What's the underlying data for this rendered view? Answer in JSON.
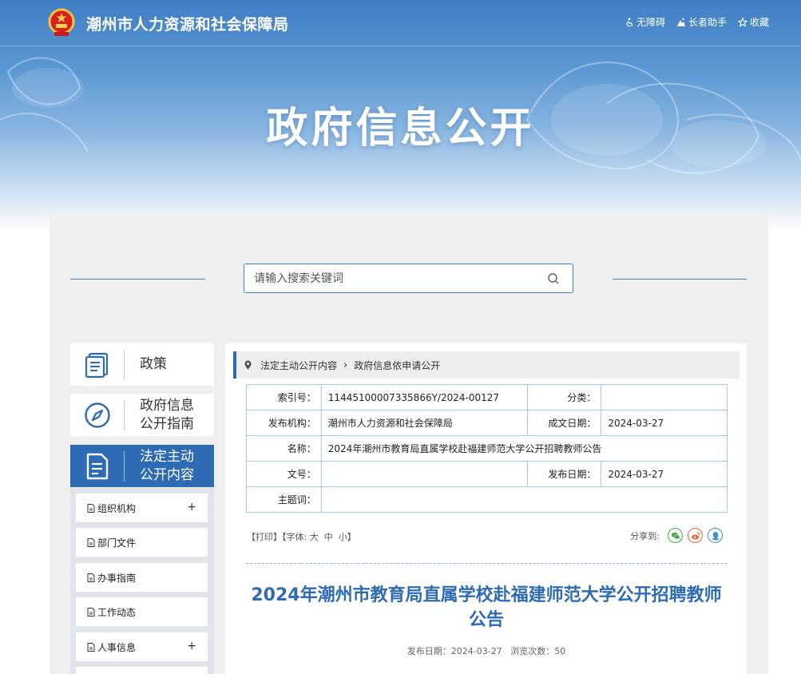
{
  "header": {
    "site_name": "潮州市人力资源和社会保障局",
    "tools": [
      {
        "label": "无障碍",
        "icon": "accessibility-icon"
      },
      {
        "label": "长者助手",
        "icon": "elder-assistant-icon"
      },
      {
        "label": "收藏",
        "icon": "star-icon"
      }
    ],
    "hero_title": "政府信息公开"
  },
  "search": {
    "placeholder": "请输入搜索关键词"
  },
  "nav": {
    "main": [
      {
        "label_lines": [
          "政策"
        ],
        "icon": "book-icon",
        "active": false
      },
      {
        "label_lines": [
          "政府信息",
          "公开指南"
        ],
        "icon": "compass-icon",
        "active": false
      },
      {
        "label_lines": [
          "法定主动",
          "公开内容"
        ],
        "icon": "document-icon",
        "active": true
      }
    ],
    "sub": [
      {
        "label": "组织机构",
        "expandable": true
      },
      {
        "label": "部门文件",
        "expandable": false
      },
      {
        "label": "办事指南",
        "expandable": false
      },
      {
        "label": "工作动态",
        "expandable": false
      },
      {
        "label": "人事信息",
        "expandable": true
      }
    ],
    "expand_symbol": "+"
  },
  "breadcrumb": {
    "items": [
      "法定主动公开内容",
      "政府信息依申请公开"
    ],
    "separator": "›"
  },
  "meta": {
    "index_label": "索引号：",
    "index_value": "11445100007335866Y/2024-00127",
    "category_label": "分类：",
    "category_value": "",
    "publisher_label": "发布机构：",
    "publisher_value": "潮州市人力资源和社会保障局",
    "written_label": "成文日期：",
    "written_value": "2024-03-27",
    "name_label": "名称：",
    "name_value": "2024年潮州市教育局直属学校赴福建师范大学公开招聘教师公告",
    "doc_no_label": "文号：",
    "doc_no_value": "",
    "published_label": "发布日期：",
    "published_value": "2024-03-27",
    "subject_label": "主题词：",
    "subject_value": ""
  },
  "toolbar": {
    "print": "【打印】",
    "font_prefix": "【字体:",
    "font_large": "大",
    "font_medium": "中",
    "font_small": "小",
    "font_suffix": "】",
    "share_label": "分享到:",
    "share_targets": [
      "wechat-icon",
      "weibo-icon",
      "qq-icon"
    ]
  },
  "article": {
    "title": "2024年潮州市教育局直属学校赴福建师范大学公开招聘教师公告",
    "publish_label": "发布日期：",
    "publish_date": "2024-03-27",
    "views_label": "浏览次数：",
    "views": "50"
  },
  "colors": {
    "primary": "#2e6bb5",
    "border": "#a9c6de",
    "wechat": "#3dae3a",
    "weibo": "#e8623b",
    "qq": "#3a8ed8"
  }
}
